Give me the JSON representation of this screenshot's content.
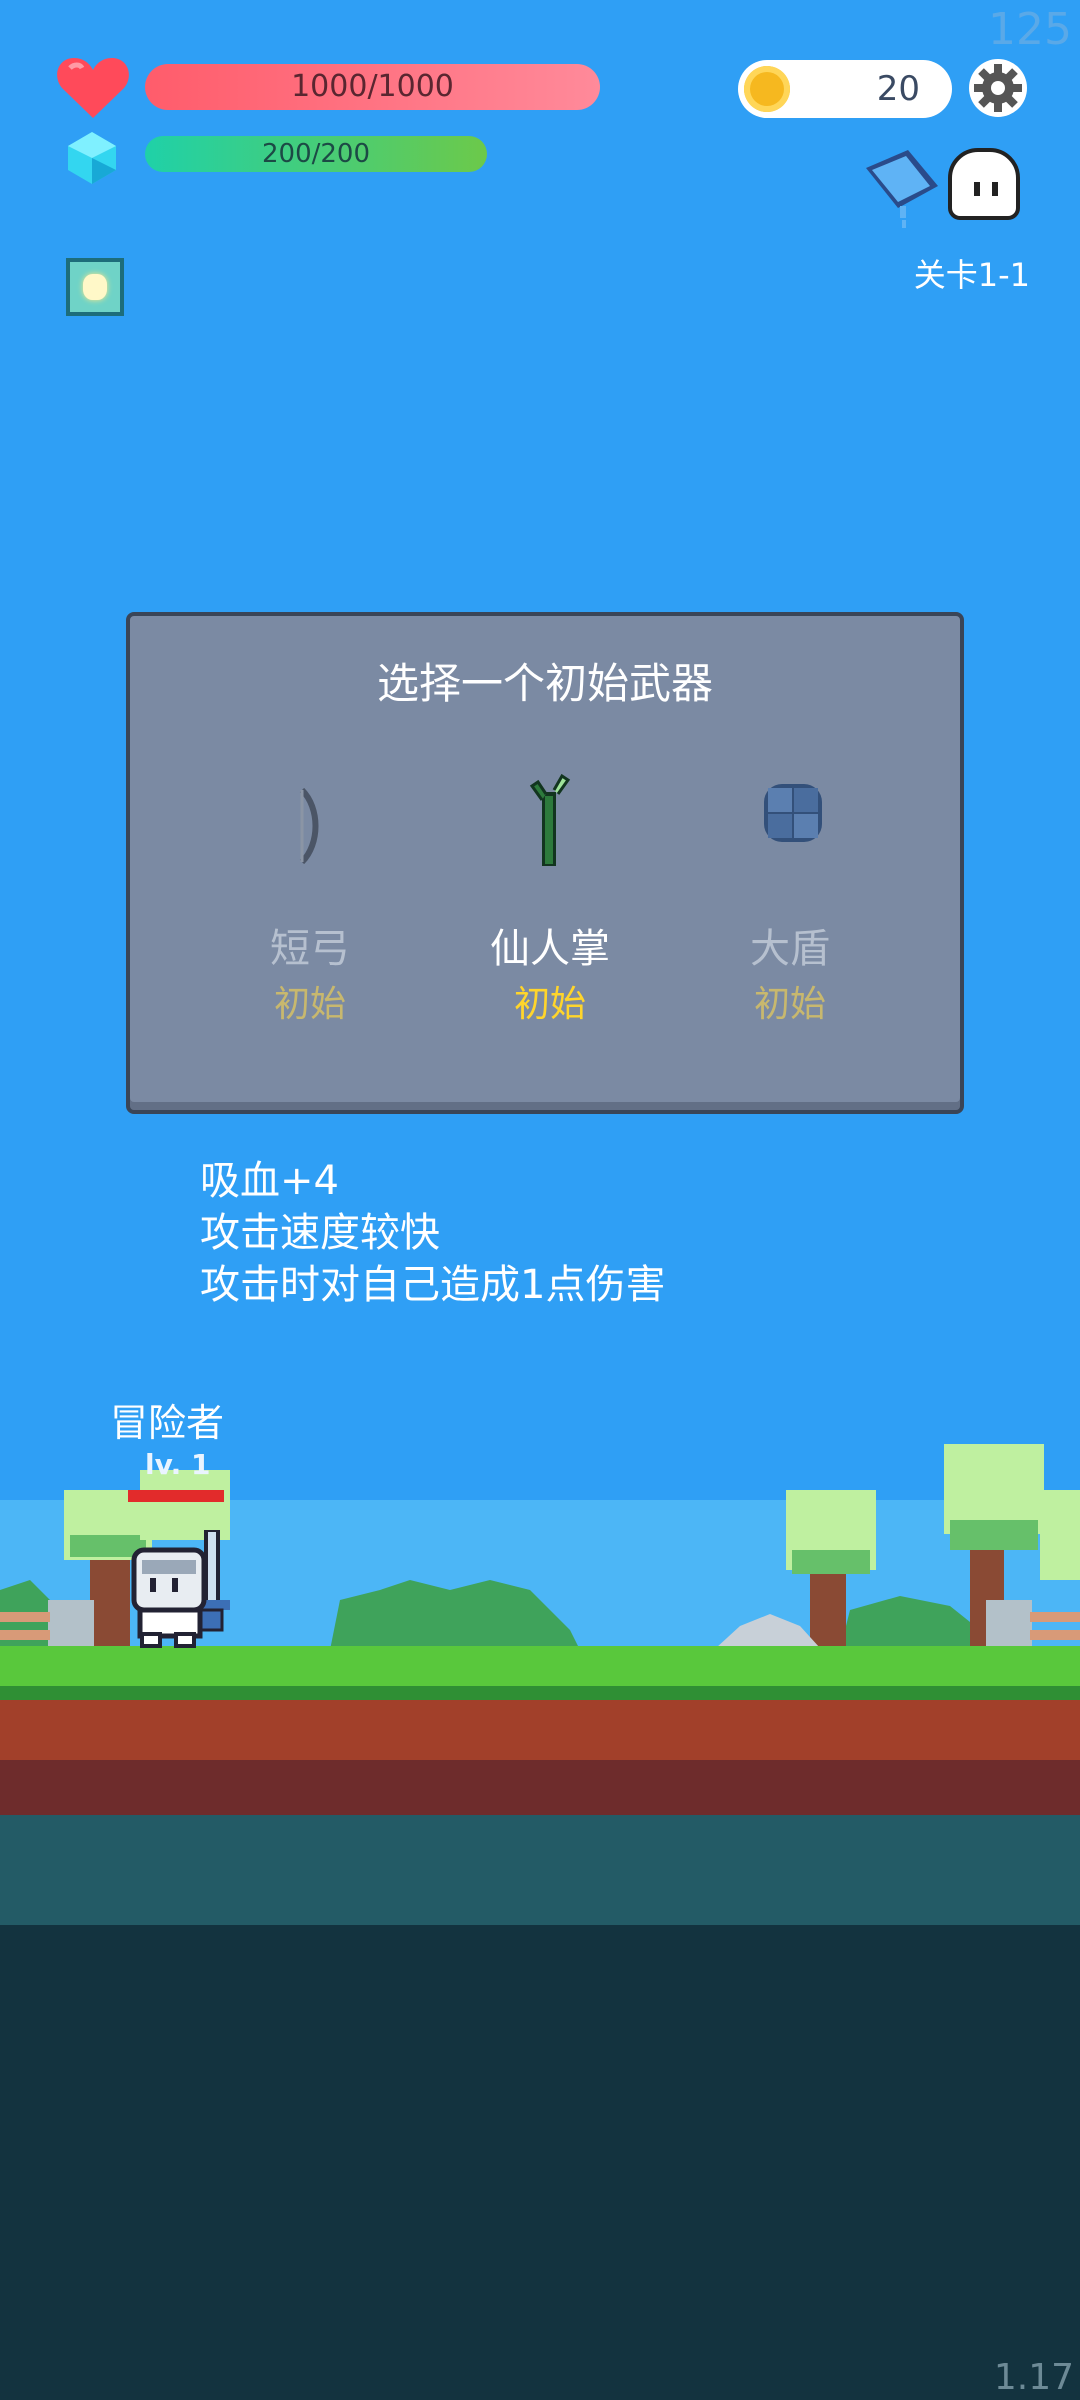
{
  "hud": {
    "fps": "125",
    "hp_text": "1000/1000",
    "hp_fraction": 1.0,
    "mp_text": "200/200",
    "mp_fraction": 1.0,
    "coins": "20",
    "level_label": "关卡1-1",
    "version": "1.17"
  },
  "dialog": {
    "title": "选择一个初始武器",
    "weapons": [
      {
        "name": "短弓",
        "tag": "初始",
        "icon": "bow-icon",
        "selected": false
      },
      {
        "name": "仙人掌",
        "tag": "初始",
        "icon": "cactus-icon",
        "selected": true
      },
      {
        "name": "大盾",
        "tag": "初始",
        "icon": "shield-icon",
        "selected": false
      }
    ]
  },
  "description": {
    "line1": "吸血+4",
    "line2": "攻击速度较快",
    "line3": "攻击时对自己造成1点伤害"
  },
  "character": {
    "name": "冒险者",
    "level": "lv. 1"
  },
  "colors": {
    "sky": "#2f9ff5",
    "hp": "#ff5c6b",
    "mp": "#1fd1a8",
    "dialog": "#7b8aa3",
    "selected_tag": "#ffd52b"
  }
}
